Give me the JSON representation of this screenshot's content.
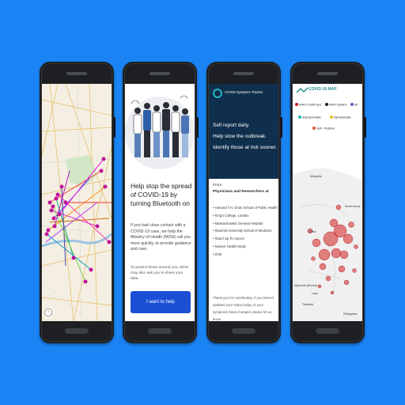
{
  "colors": {
    "background": "#1b84f5",
    "phone_body": "#1d1f22",
    "map_land": "#f4efe2",
    "tracker_header": "#0f2f4c",
    "primary_button": "#1a4fd6",
    "case_circle": "#d41f1f"
  },
  "phone2": {
    "title": "Help stop the spread of COVID-19 by turning Bluetooth on",
    "body": "If you had close contact with a COVID-19 case, we help the Ministry of Health (MOH) call you more quickly, to provide guidance and care.",
    "note": "To protect those around you, MOH may also ask you to share your data.",
    "button": "I want to help"
  },
  "phone3": {
    "app_title": "COVID Symptom Tracker",
    "hero": [
      "Self report daily.",
      "Help slow the outbreak.",
      "Identify those at risk sooner."
    ],
    "from": "From",
    "physicians": "Physicians and Researchers at",
    "institutions": [
      "Harvard T.H. Chan School of Public Health",
      "King's College, London",
      "Massachusetts General Hospital",
      "Stanford University School of Medicine",
      "Stand Up To Cancer",
      "Nurses' Health Study",
      "ZOE"
    ],
    "thanks": "Thank you for contributing. If you haven't updated your status today or your symptoms have changed, please let us know."
  },
  "phone4": {
    "logo": "COVID-19 MAP",
    "legend": [
      "WHO Confirmed",
      "WHO Deaths",
      "All",
      "Asymptomatic",
      "Symptomatic",
      "Self - Positive"
    ],
    "map_labels": [
      "Mongolia",
      "North Korea",
      "China",
      "Myanmar (Burma)",
      "Laos",
      "Thailand",
      "Philippines"
    ]
  }
}
